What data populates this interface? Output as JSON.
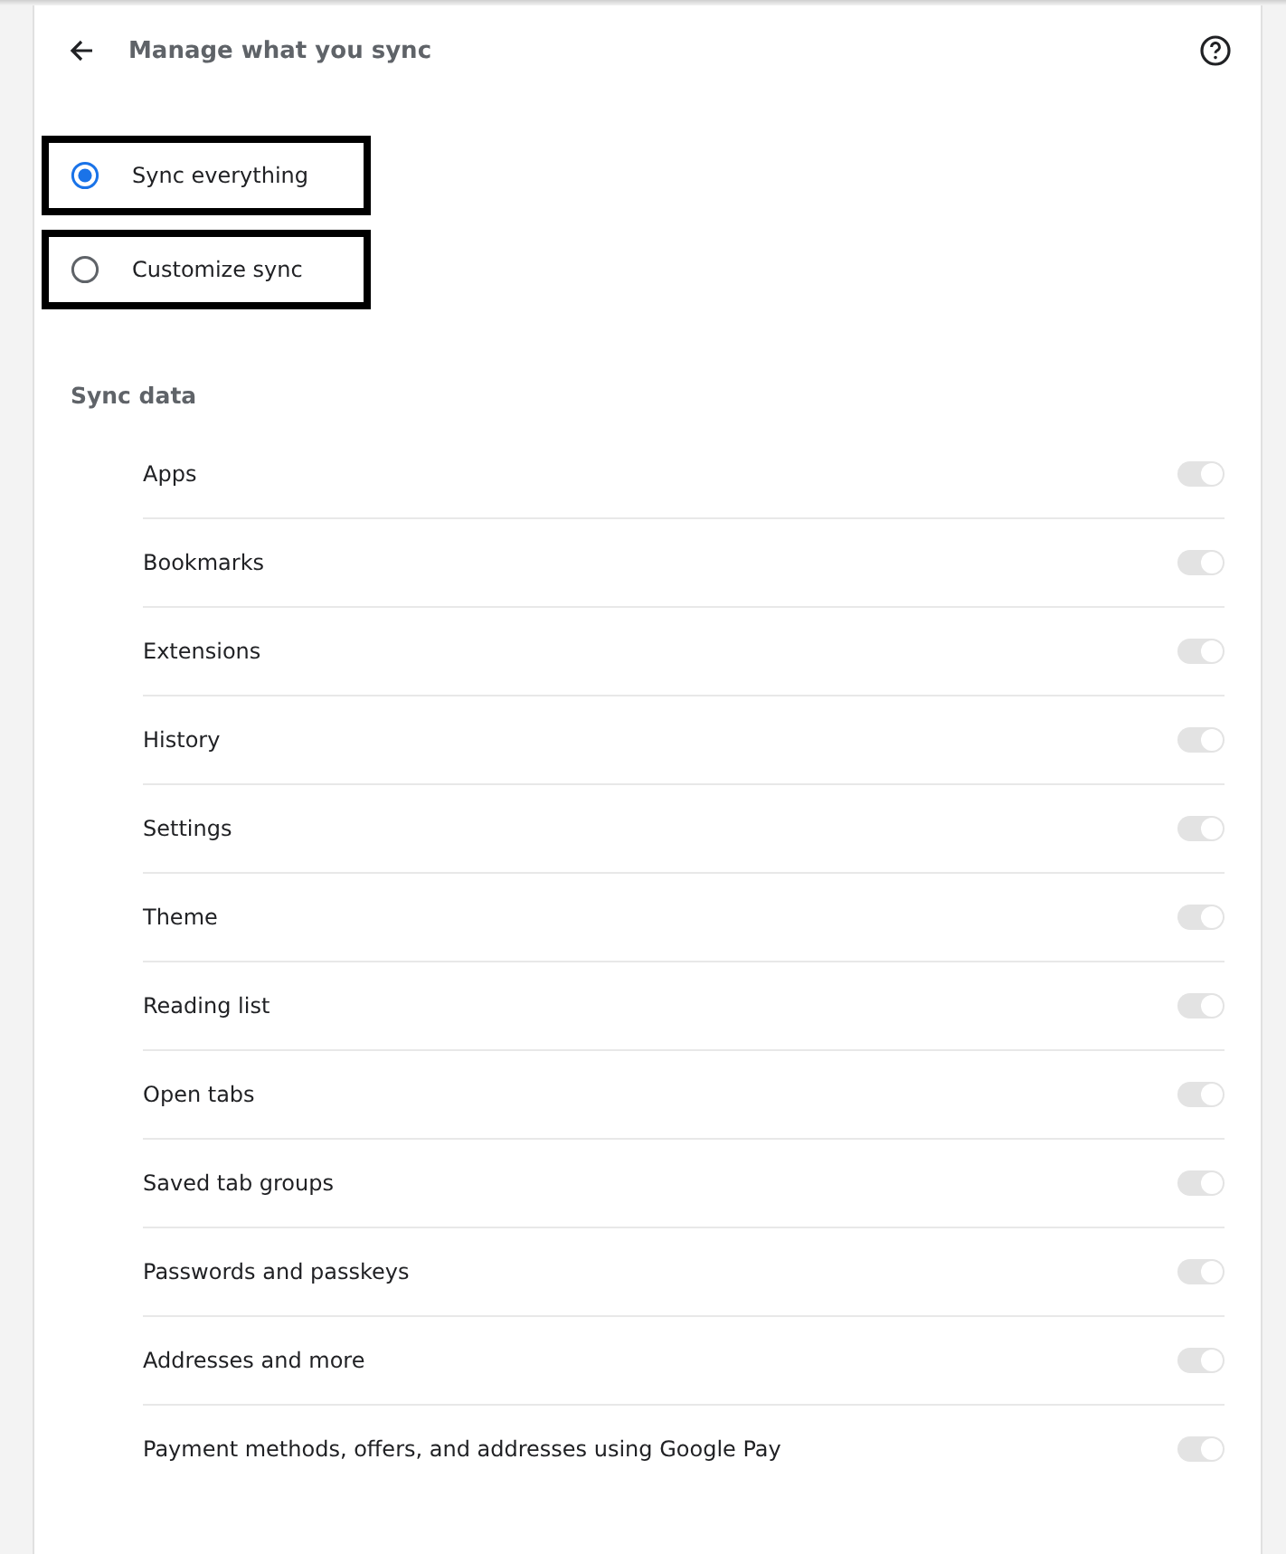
{
  "header": {
    "title": "Manage what you sync"
  },
  "sync_options": [
    {
      "label": "Sync everything",
      "selected": true,
      "highlighted": true
    },
    {
      "label": "Customize sync",
      "selected": false,
      "highlighted": true
    }
  ],
  "section": {
    "title": "Sync data"
  },
  "items": [
    {
      "label": "Apps",
      "on": true,
      "disabled": true
    },
    {
      "label": "Bookmarks",
      "on": true,
      "disabled": true
    },
    {
      "label": "Extensions",
      "on": true,
      "disabled": true
    },
    {
      "label": "History",
      "on": true,
      "disabled": true
    },
    {
      "label": "Settings",
      "on": true,
      "disabled": true
    },
    {
      "label": "Theme",
      "on": true,
      "disabled": true
    },
    {
      "label": "Reading list",
      "on": true,
      "disabled": true
    },
    {
      "label": "Open tabs",
      "on": true,
      "disabled": true
    },
    {
      "label": "Saved tab groups",
      "on": true,
      "disabled": true
    },
    {
      "label": "Passwords and passkeys",
      "on": true,
      "disabled": true
    },
    {
      "label": "Addresses and more",
      "on": true,
      "disabled": true
    },
    {
      "label": "Payment methods, offers, and addresses using Google Pay",
      "on": true,
      "disabled": true
    }
  ]
}
